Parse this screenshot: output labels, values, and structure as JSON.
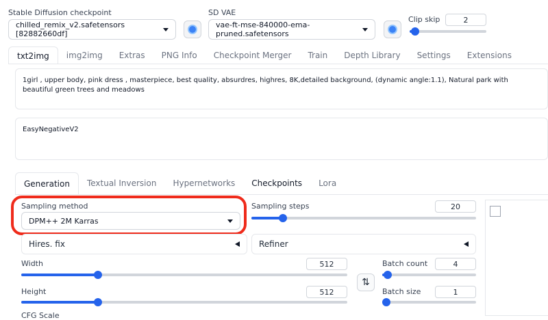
{
  "top": {
    "checkpoint_label": "Stable Diffusion checkpoint",
    "checkpoint_value": "chilled_remix_v2.safetensors [82882660df]",
    "vae_label": "SD VAE",
    "vae_value": "vae-ft-mse-840000-ema-pruned.safetensors",
    "clip_skip_label": "Clip skip",
    "clip_skip_value": "2"
  },
  "main_tabs": [
    {
      "label": "txt2img",
      "active": true
    },
    {
      "label": "img2img"
    },
    {
      "label": "Extras"
    },
    {
      "label": "PNG Info"
    },
    {
      "label": "Checkpoint Merger"
    },
    {
      "label": "Train"
    },
    {
      "label": "Depth Library"
    },
    {
      "label": "Settings"
    },
    {
      "label": "Extensions"
    }
  ],
  "prompt": {
    "positive": "1girl , upper body, pink dress , masterpiece, best quality, absurdres, highres, 8K,detailed background, (dynamic angle:1.1), Natural park with beautiful green trees and meadows",
    "negative": "EasyNegativeV2"
  },
  "sub_tabs": [
    {
      "label": "Generation",
      "active": true
    },
    {
      "label": "Textual Inversion"
    },
    {
      "label": "Hypernetworks"
    },
    {
      "label": "Checkpoints"
    },
    {
      "label": "Lora"
    }
  ],
  "generation": {
    "sampling_method_label": "Sampling method",
    "sampling_method_value": "DPM++ 2M Karras",
    "sampling_steps_label": "Sampling steps",
    "sampling_steps_value": "20",
    "hires_fix_label": "Hires. fix",
    "refiner_label": "Refiner",
    "width_label": "Width",
    "width_value": "512",
    "height_label": "Height",
    "height_value": "512",
    "batch_count_label": "Batch count",
    "batch_count_value": "4",
    "batch_size_label": "Batch size",
    "batch_size_value": "1",
    "cfg_label": "CFG Scale",
    "swap_glyph": "⇅"
  },
  "colors": {
    "accent": "#2563eb",
    "highlight": "#ef2b1b"
  }
}
